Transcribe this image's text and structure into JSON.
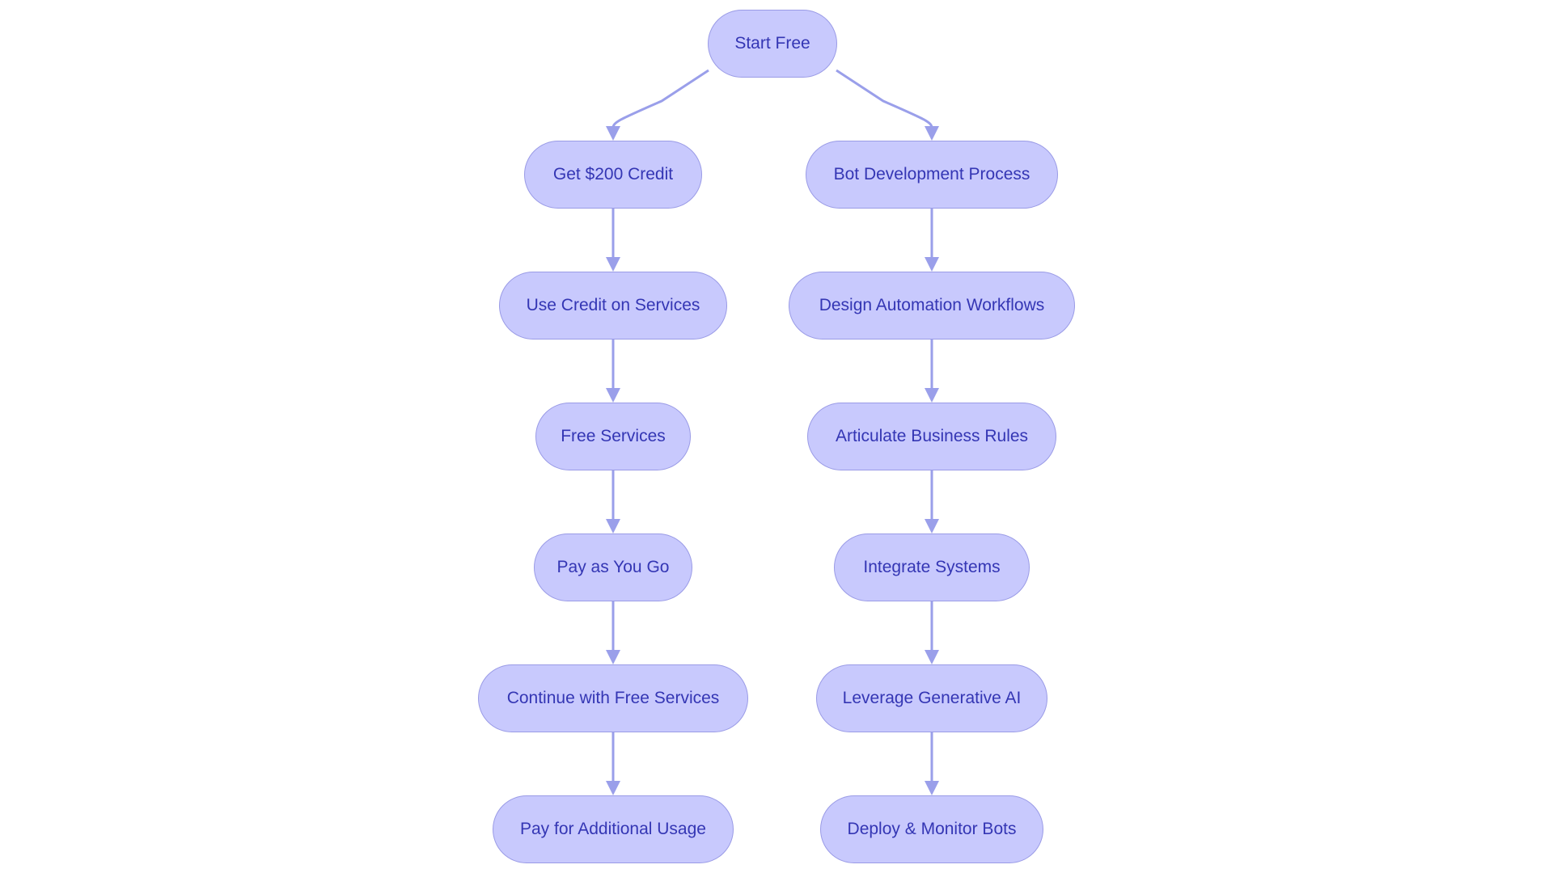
{
  "diagram": {
    "type": "flowchart",
    "direction": "top-down",
    "colors": {
      "node_fill": "#c8c9fd",
      "node_stroke": "#9a9be6",
      "text": "#3436b4",
      "edge": "#9a9fea"
    },
    "root": {
      "id": "start",
      "label": "Start Free"
    },
    "left_branch": [
      {
        "id": "credit",
        "label": "Get $200 Credit"
      },
      {
        "id": "use_credit",
        "label": "Use Credit on Services"
      },
      {
        "id": "free_services",
        "label": "Free Services"
      },
      {
        "id": "payg",
        "label": "Pay as You Go"
      },
      {
        "id": "continue_free",
        "label": "Continue with Free Services"
      },
      {
        "id": "pay_additional",
        "label": "Pay for Additional Usage"
      }
    ],
    "right_branch": [
      {
        "id": "bot_dev",
        "label": "Bot Development Process"
      },
      {
        "id": "design",
        "label": "Design Automation Workflows"
      },
      {
        "id": "rules",
        "label": "Articulate Business Rules"
      },
      {
        "id": "integrate",
        "label": "Integrate Systems"
      },
      {
        "id": "genai",
        "label": "Leverage Generative AI"
      },
      {
        "id": "deploy",
        "label": "Deploy & Monitor Bots"
      }
    ],
    "edges": [
      [
        "start",
        "credit"
      ],
      [
        "credit",
        "use_credit"
      ],
      [
        "use_credit",
        "free_services"
      ],
      [
        "free_services",
        "payg"
      ],
      [
        "payg",
        "continue_free"
      ],
      [
        "continue_free",
        "pay_additional"
      ],
      [
        "start",
        "bot_dev"
      ],
      [
        "bot_dev",
        "design"
      ],
      [
        "design",
        "rules"
      ],
      [
        "rules",
        "integrate"
      ],
      [
        "integrate",
        "genai"
      ],
      [
        "genai",
        "deploy"
      ]
    ]
  }
}
